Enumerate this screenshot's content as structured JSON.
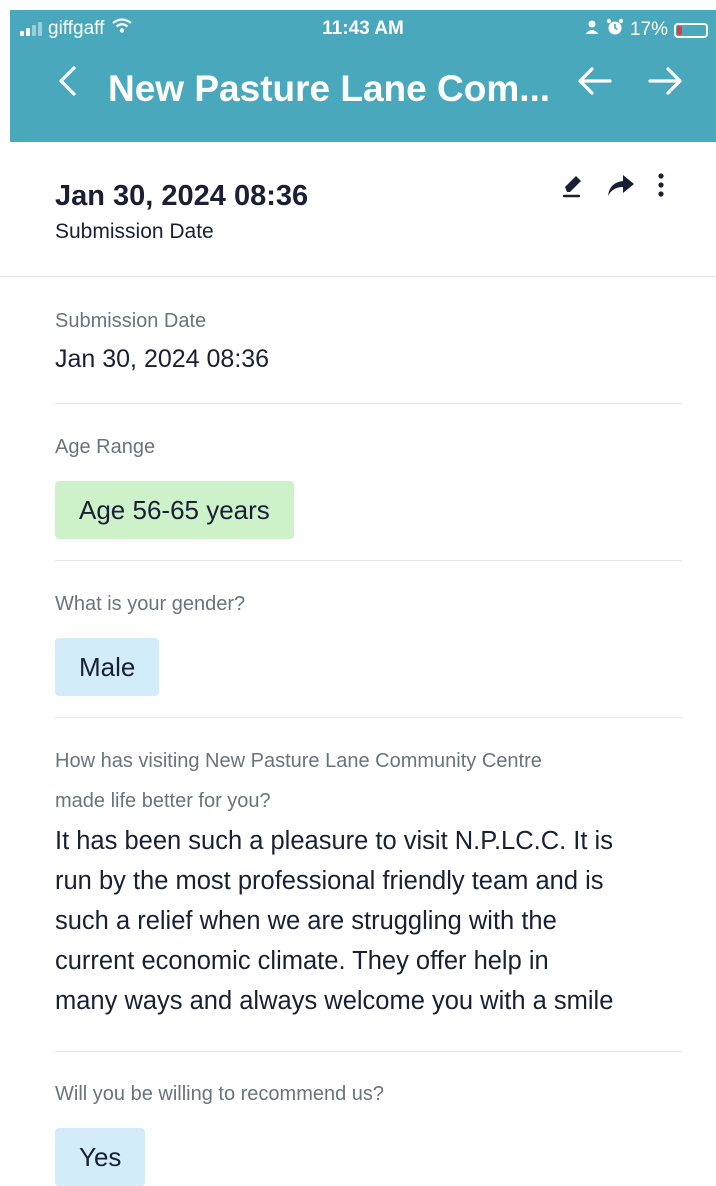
{
  "status_bar": {
    "carrier": "giffgaff",
    "time": "11:43 AM",
    "battery_percent": "17%",
    "battery_level": 0.17,
    "signal_bars": 2,
    "icons": [
      "signal-icon",
      "wifi-icon",
      "person-icon",
      "alarm-icon",
      "battery-icon"
    ]
  },
  "nav": {
    "title": "New Pasture Lane Com...",
    "back_icon": "chevron-left-icon",
    "prev_icon": "arrow-left-icon",
    "next_icon": "arrow-right-icon"
  },
  "summary": {
    "date": "Jan 30, 2024 08:36",
    "label": "Submission Date",
    "actions": [
      "edit-icon",
      "share-icon",
      "more-icon"
    ]
  },
  "fields": {
    "submission_date": {
      "label": "Submission Date",
      "value": "Jan 30, 2024 08:36"
    },
    "age_range": {
      "label": "Age Range",
      "value": "Age 56-65 years"
    },
    "gender": {
      "label": "What is your gender?",
      "value": "Male"
    },
    "better_life": {
      "label_line1": "How has visiting New Pasture Lane Community Centre",
      "label_line2": "made life better for you?",
      "answer_lines": [
        "It has been such a pleasure to visit N.P.LC.C. It is",
        "run by the most professional friendly team and is",
        "such a relief when we are struggling with the",
        "current economic climate. They offer help in",
        "many ways and always welcome you with a smile"
      ]
    },
    "recommend": {
      "label": "Will you be willing to recommend us?",
      "value": "Yes"
    }
  },
  "colors": {
    "header_bg": "#4aa8bd",
    "chip_green": "#cdf2c9",
    "chip_blue": "#d3ecfa",
    "battery_low": "#e23b3b"
  }
}
